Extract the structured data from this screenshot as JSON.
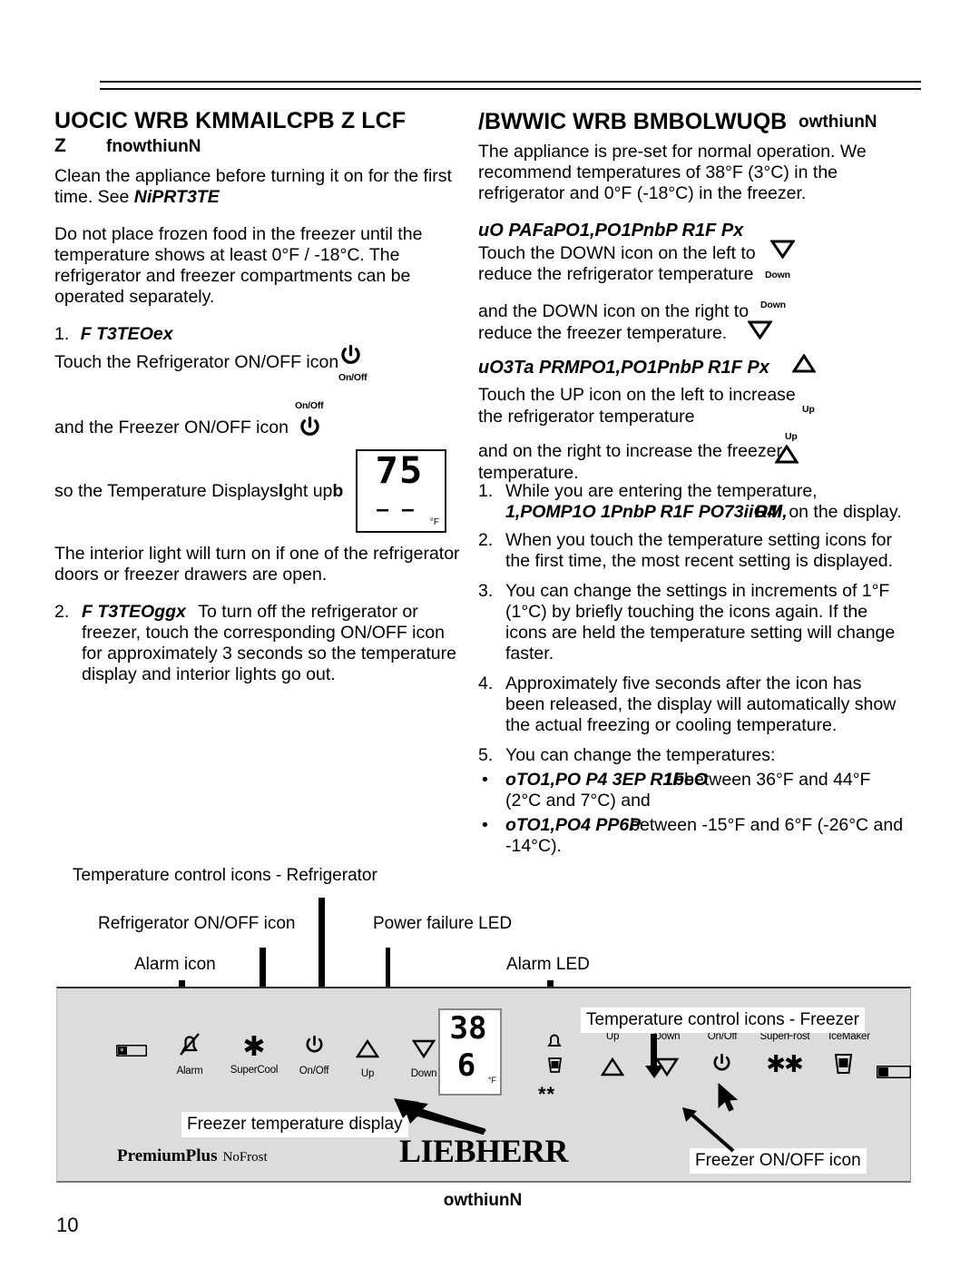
{
  "page": {
    "number": "10"
  },
  "left": {
    "heading": "UOCIC WRB KMMAILCPB Z LCF",
    "sub_mark": "Z",
    "sub_word": "fnowthiunN",
    "para1": "Clean the appliance before turning it on for the first time. See ",
    "para1_ref": "NiPRT3TE",
    "para2": "Do not place frozen food in the freezer until the temperature shows at least 0°F / -18°C. The refrigerator and freezer compartments can be operated separately.",
    "item1_num": "1.",
    "item1_title": "F T3TEOex",
    "item1_line1": "Touch the Refrigerator ON/OFF icon",
    "icon_onoff_label": "On/Off",
    "item1_line2": "and the Freezer ON/OFF icon",
    "item1_line3a": "so the Temperature Displays",
    "item1_line3b": "l",
    "item1_line3c": "ght up",
    "item1_line3d": "b",
    "lcd": {
      "value": "75",
      "dashes": "– –",
      "unit": "°F"
    },
    "para3": "The interior light will turn on if one of the refrigerator doors or freezer drawers are open.",
    "item2_num": "2.",
    "item2_title": "F T3TEOggx",
    "item2_text": "To turn off the refrigerator or freezer, touch the corresponding ON/OFF icon for approximately 3 seconds so the temperature display and interior lights go out."
  },
  "right": {
    "heading_a": "/BWWIC WRB BMBOLWUQB",
    "heading_b": "owthiunN",
    "para1": "The appliance is pre-set for normal operation. We recommend temperatures of 38°F (3°C) in the refrigerator and 0°F (-18°C) in the freezer.",
    "h_down": "uO PAFaPO1,PO1PnbP R1F Px",
    "down_line1": "Touch the DOWN icon on the left to",
    "down_line2": "reduce the refrigerator temperature",
    "down_label": "Down",
    "down_line3": "and the DOWN icon on the right to",
    "down_line4": "reduce the freezer temperature.",
    "h_up": "uO3Ta PRMPO1,PO1PnbP R1F Px",
    "up_line1": "Touch the UP icon on the left to increase",
    "up_line2": "the refrigerator temperature",
    "up_label": "Up",
    "up_line3": "and on the right to increase the freezer",
    "up_line4": "temperature.",
    "items": [
      {
        "num": "1.",
        "plain_a": "While you are entering the temperature, ",
        "ital_a": "1,POMP1O 1PnbP R1F PO73iiO4i",
        "ital_b": "BM",
        "plain_b": "on the display.",
        "plain_c": "RM,"
      },
      {
        "num": "2.",
        "text": "When you touch the temperature setting icons for the first time, the most recent setting is displayed."
      },
      {
        "num": "3.",
        "text": "You can change the settings in increments of 1°F (1°C) by briefly touching the icons again. If the icons are held the temperature setting will change faster."
      },
      {
        "num": "4.",
        "text": "Approximately five seconds after the icon has been released, the display will automatically show the actual freezing or cooling temperature."
      },
      {
        "num": "5.",
        "text": "You can change the temperatures:"
      }
    ],
    "bullets": [
      {
        "bullet": "•",
        "ital": "oTO1,PO P4 3EP R1F",
        "ital_over": "1beO",
        "plain": "between 36°F and 44°F (2°C and 7°C) and"
      },
      {
        "bullet": "•",
        "ital": "oTO1,PO4 PP6P",
        "plain": "between -15°F and 6°F (-26°C and -14°C)."
      }
    ]
  },
  "diagram": {
    "callouts": {
      "temp_ctrl_fridge": "Temperature control icons - Refrigerator",
      "fridge_onoff": "Refrigerator ON/OFF icon",
      "alarm_icon": "Alarm icon",
      "power_failure_led": "Power failure LED",
      "alarm_led": "Alarm LED",
      "temp_ctrl_freezer": "Temperature control icons - Freezer",
      "freezer_temp_display": "Freezer temperature display",
      "freezer_onoff": "Freezer ON/OFF icon"
    },
    "left_icons": [
      {
        "glyph": "icemaker-bar-icon",
        "label": ""
      },
      {
        "glyph": "alarm-bell-off-icon",
        "label": "Alarm"
      },
      {
        "glyph": "supercool-snowflake-icon",
        "label": "SuperCool"
      },
      {
        "glyph": "power-icon",
        "label": "On/Off"
      },
      {
        "glyph": "up-triangle-icon",
        "label": "Up"
      },
      {
        "glyph": "down-triangle-icon",
        "label": "Down"
      },
      {
        "glyph": "power-failure-icon",
        "label": ""
      }
    ],
    "right_icons": [
      {
        "glyph": "up-triangle-icon",
        "label": "Up"
      },
      {
        "glyph": "down-triangle-icon",
        "label": "Down"
      },
      {
        "glyph": "power-icon",
        "label": "On/Off"
      },
      {
        "glyph": "superfrost-snowflakes-icon",
        "label": "SuperFrost"
      },
      {
        "glyph": "icemaker-glass-icon",
        "label": "IceMaker"
      },
      {
        "glyph": "icemaker-bar-icon",
        "label": ""
      }
    ],
    "led_alarm": "alarm-bell-icon",
    "led_icemaker": "icemaker-glass-small-icon",
    "star_left": "*",
    "star_right": "**",
    "lcd": {
      "top": "38",
      "bottom": "6",
      "unit": "°F"
    },
    "brand_premium": "PremiumPlus",
    "brand_nofrost": "NoFrost",
    "brand_logo": "LIEBHERR",
    "caption": "owthiunN"
  }
}
